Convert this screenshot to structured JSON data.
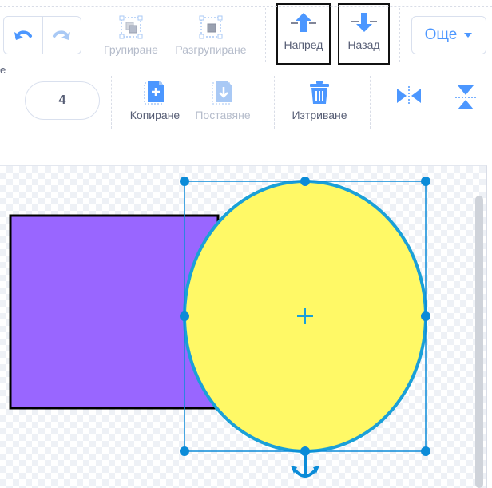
{
  "toolbar": {
    "partial_label": "е",
    "group_label": "Групиране",
    "ungroup_label": "Разгрупиране",
    "forward_label": "Напред",
    "backward_label": "Назад",
    "more_label": "Още",
    "size_value": "4",
    "copy_label": "Копиране",
    "paste_label": "Поставяне",
    "delete_label": "Изтриване"
  },
  "icons": {
    "undo": "undo-icon",
    "redo": "redo-icon",
    "group": "group-icon",
    "ungroup": "ungroup-icon",
    "forward": "forward-arrow-icon",
    "backward": "backward-arrow-icon",
    "more": "chevron-down-icon",
    "copy": "copy-icon",
    "paste": "paste-icon",
    "delete": "trash-icon",
    "flip_h": "flip-horizontal-icon",
    "flip_v": "flip-vertical-icon",
    "rotate": "rotate-handle-icon",
    "center": "center-crosshair-icon"
  },
  "colors": {
    "accent": "#4c97ff",
    "text": "#575e75",
    "disabled": "#b5bccb",
    "rectangle_fill": "#9966ff",
    "ellipse_fill": "#fff966",
    "selection": "#0b8bd8",
    "ellipse_stroke": "#1aa0d8"
  }
}
